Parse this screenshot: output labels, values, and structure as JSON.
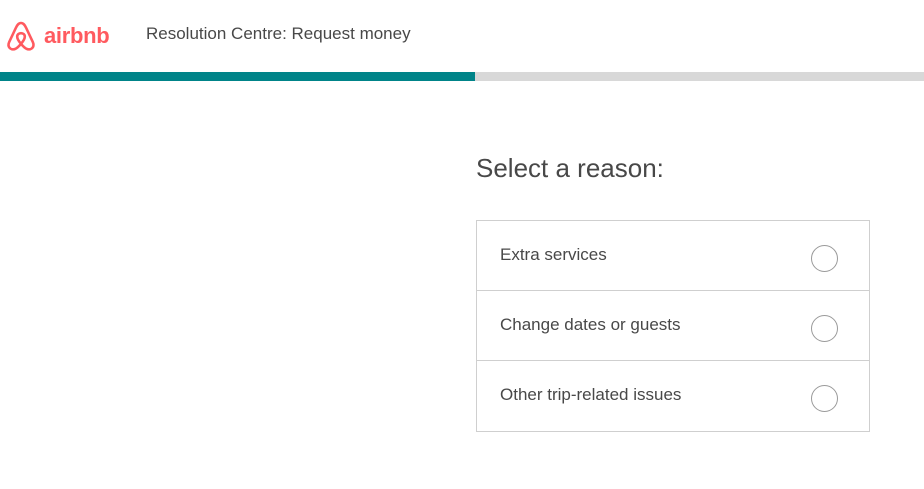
{
  "brand": {
    "logo_icon": "airbnb-belo-icon",
    "name": "airbnb",
    "color": "#FF5A5F"
  },
  "header": {
    "title": "Resolution Centre: Request money"
  },
  "progress": {
    "fraction": 0.514,
    "fill_color": "#008489",
    "track_color": "#D8D8D8"
  },
  "main": {
    "question": "Select a reason:",
    "options": [
      {
        "label": "Extra services",
        "selected": false
      },
      {
        "label": "Change dates or guests",
        "selected": false
      },
      {
        "label": "Other trip-related issues",
        "selected": false
      }
    ]
  }
}
